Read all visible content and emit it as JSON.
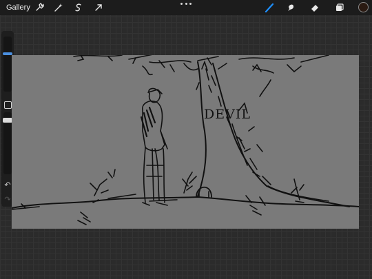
{
  "app": {
    "gallery_label": "Gallery"
  },
  "toolbar": {
    "left_tools": [
      "wrench-icon",
      "magic-wand-icon",
      "selection-icon",
      "transform-arrow-icon"
    ],
    "right_tools": [
      "brush-icon",
      "smudge-icon",
      "eraser-icon",
      "layers-icon"
    ],
    "active_tool": "brush",
    "accent_color": "#1e90ff",
    "current_color": "#2a1a12"
  },
  "sidebar": {
    "brush_size_level": 0.15,
    "opacity_level": 0.05,
    "modify_button": "square-icon",
    "undo": "undo-icon",
    "redo": "redo-icon"
  },
  "canvas": {
    "background_color": "#7a7a7a",
    "drawing_text": "DEVIL"
  }
}
